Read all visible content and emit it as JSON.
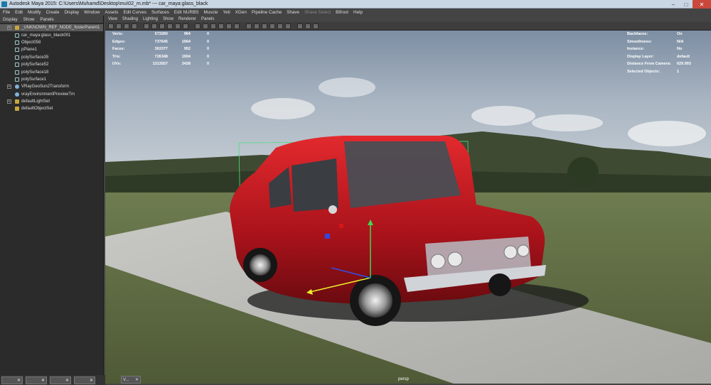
{
  "title_bar": {
    "text": "Autodesk Maya 2015: C:\\Users\\Muhamd\\Desktop\\mu\\02_m.mb*   ---   car_maya:glass_black",
    "minimize": "–",
    "maximize": "□",
    "close": "✕"
  },
  "menubar": {
    "items": [
      "File",
      "Edit",
      "Modify",
      "Create",
      "Display",
      "Window",
      "Assets",
      "Edit Curves",
      "Surfaces",
      "Edit NURBS",
      "Muscle",
      "Yeti",
      "XGen",
      "Pipeline Cache",
      "Shave",
      "Shave Select",
      "Bifrost",
      "Help"
    ]
  },
  "outliner": {
    "menu": [
      "Display",
      "Show",
      "Panels"
    ],
    "items": [
      {
        "label": "_UNKNOWN_REF_NODE_fosterParent1",
        "expand": "+",
        "selected": true
      },
      {
        "label": "car_maya:glass_black001",
        "expand": ""
      },
      {
        "label": "Object058",
        "expand": ""
      },
      {
        "label": "pPlane1",
        "expand": ""
      },
      {
        "label": "polySurface35",
        "expand": ""
      },
      {
        "label": "polySurface52",
        "expand": ""
      },
      {
        "label": "polySurface18",
        "expand": ""
      },
      {
        "label": "polySurface1",
        "expand": ""
      },
      {
        "label": "VRayGeoSun2Transform",
        "expand": "+"
      },
      {
        "label": "vrayEnvironmentPreviewTm",
        "expand": ""
      },
      {
        "label": "defaultLightSet",
        "expand": "+"
      },
      {
        "label": "defaultObjectSet",
        "expand": ""
      }
    ]
  },
  "viewport_menu": [
    "View",
    "Shading",
    "Lighting",
    "Show",
    "Renderer",
    "Panels"
  ],
  "hud_left": [
    {
      "label": "Verts:",
      "v1": "573260",
      "v2": "964",
      "v3": "0"
    },
    {
      "label": "Edges:",
      "v1": "737645",
      "v2": "1964",
      "v3": "0"
    },
    {
      "label": "Faces:",
      "v1": "363377",
      "v2": "952",
      "v3": "0"
    },
    {
      "label": "Tris:",
      "v1": "726348",
      "v2": "1904",
      "v3": "0"
    },
    {
      "label": "UVs:",
      "v1": "1313557",
      "v2": "3428",
      "v3": "0"
    }
  ],
  "hud_right": [
    {
      "label": "Backfaces:",
      "value": "On"
    },
    {
      "label": "Smoothness:",
      "value": "N/A"
    },
    {
      "label": "Instance:",
      "value": "No"
    },
    {
      "label": "Display Layer:",
      "value": "default"
    },
    {
      "label": "Distance From Camera:",
      "value": "629.993"
    },
    {
      "label": "Selected Objects:",
      "value": "1"
    }
  ],
  "camera_label": "persp",
  "taskbar": {
    "tasks": [
      "✕",
      "✕",
      "✕",
      "✕"
    ],
    "viewport_task": "V...",
    "viewport_close": "✕"
  }
}
